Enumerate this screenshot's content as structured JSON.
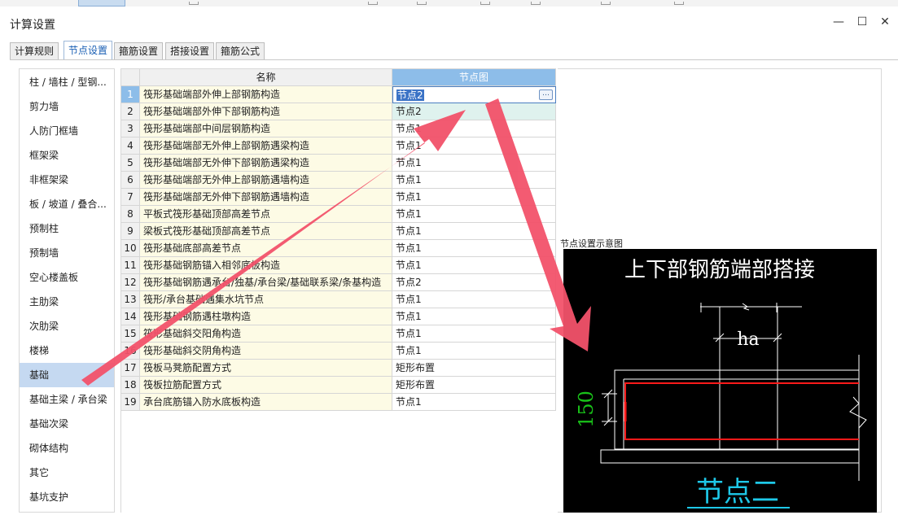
{
  "window": {
    "title": "计算设置"
  },
  "tabs": [
    {
      "label": "计算规则"
    },
    {
      "label": "节点设置"
    },
    {
      "label": "箍筋设置"
    },
    {
      "label": "搭接设置"
    },
    {
      "label": "箍筋公式"
    }
  ],
  "active_tab": "节点设置",
  "sidebar": {
    "items": [
      {
        "label": "柱 / 墙柱 / 型钢..."
      },
      {
        "label": "剪力墙"
      },
      {
        "label": "人防门框墙"
      },
      {
        "label": "框架梁"
      },
      {
        "label": "非框架梁"
      },
      {
        "label": "板 / 坡道 / 叠合..."
      },
      {
        "label": "预制柱"
      },
      {
        "label": "预制墙"
      },
      {
        "label": "空心楼盖板"
      },
      {
        "label": "主肋梁"
      },
      {
        "label": "次肋梁"
      },
      {
        "label": "楼梯"
      },
      {
        "label": "基础"
      },
      {
        "label": "基础主梁 / 承台梁"
      },
      {
        "label": "基础次梁"
      },
      {
        "label": "砌体结构"
      },
      {
        "label": "其它"
      },
      {
        "label": "基坑支护"
      }
    ],
    "selected": "基础"
  },
  "table": {
    "headers": {
      "name": "名称",
      "node": "节点图"
    },
    "rows": [
      {
        "num": "1",
        "name": "筏形基础端部外伸上部钢筋构造",
        "node": "节点2"
      },
      {
        "num": "2",
        "name": "筏形基础端部外伸下部钢筋构造",
        "node": "节点2"
      },
      {
        "num": "3",
        "name": "筏形基础端部中间层钢筋构造",
        "node": "节点1"
      },
      {
        "num": "4",
        "name": "筏形基础端部无外伸上部钢筋遇梁构造",
        "node": "节点1"
      },
      {
        "num": "5",
        "name": "筏形基础端部无外伸下部钢筋遇梁构造",
        "node": "节点1"
      },
      {
        "num": "6",
        "name": "筏形基础端部无外伸上部钢筋遇墙构造",
        "node": "节点1"
      },
      {
        "num": "7",
        "name": "筏形基础端部无外伸下部钢筋遇墙构造",
        "node": "节点1"
      },
      {
        "num": "8",
        "name": "平板式筏形基础顶部高差节点",
        "node": "节点1"
      },
      {
        "num": "9",
        "name": "梁板式筏形基础顶部高差节点",
        "node": "节点1"
      },
      {
        "num": "10",
        "name": "筏形基础底部高差节点",
        "node": "节点1"
      },
      {
        "num": "11",
        "name": "筏形基础钢筋锚入相邻底板构造",
        "node": "节点1"
      },
      {
        "num": "12",
        "name": "筏形基础钢筋遇承台/独基/承台梁/基础联系梁/条基构造",
        "node": "节点2"
      },
      {
        "num": "13",
        "name": "筏形/承台基础遇集水坑节点",
        "node": "节点1"
      },
      {
        "num": "14",
        "name": "筏形基础钢筋遇柱墩构造",
        "node": "节点1"
      },
      {
        "num": "15",
        "name": "筏形基础斜交阳角构造",
        "node": "节点1"
      },
      {
        "num": "16",
        "name": "筏形基础斜交阴角构造",
        "node": "节点1"
      },
      {
        "num": "17",
        "name": "筏板马凳筋配置方式",
        "node": "矩形布置"
      },
      {
        "num": "18",
        "name": "筏板拉筋配置方式",
        "node": "矩形布置"
      },
      {
        "num": "19",
        "name": "承台底筋锚入防水底板构造",
        "node": "节点1"
      }
    ]
  },
  "diagram_panel": {
    "label": "节点设置示意图",
    "heading": "上下部钢筋端部搭接",
    "dimension_ha": "ha",
    "dimension_150": "150",
    "node_caption": "节点二"
  },
  "colors": {
    "sidebar_selected": "#c5d9f1",
    "header_selected": "#8dbde9",
    "name_cell_bg": "#fdfbe5",
    "arrow": "#f2526a",
    "diagram_bg": "#000000",
    "diagram_heading": "#ffffff",
    "diagram_caption": "#1ec8e8",
    "dimension_green": "#19c219",
    "rebar_red": "#ff1a1a"
  },
  "icons": {
    "minimize": "minimize-icon",
    "maximize": "maximize-icon",
    "close": "close-icon",
    "ellipsis": "ellipsis-button-icon"
  }
}
